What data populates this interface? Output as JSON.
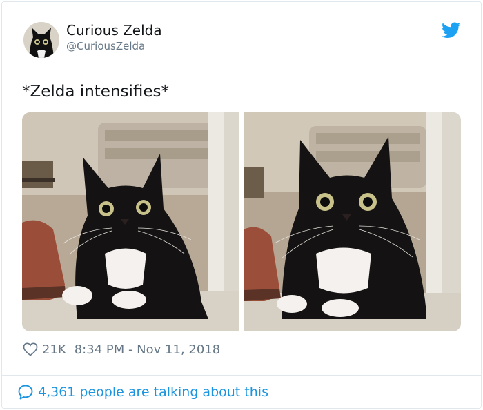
{
  "author": {
    "name": "Curious Zelda",
    "handle": "@CuriousZelda"
  },
  "tweet": {
    "text": "*Zelda intensifies*",
    "likes": "21K",
    "timestamp": "8:34 PM - Nov 11, 2018"
  },
  "footer": {
    "talking": "4,361 people are talking about this"
  },
  "icons": {
    "brand": "twitter-bird-icon",
    "like": "heart-icon",
    "reply": "speech-bubble-icon"
  },
  "colors": {
    "twitter_blue": "#1da1f2",
    "link_blue": "#1b95e0",
    "secondary_text": "#657786"
  }
}
